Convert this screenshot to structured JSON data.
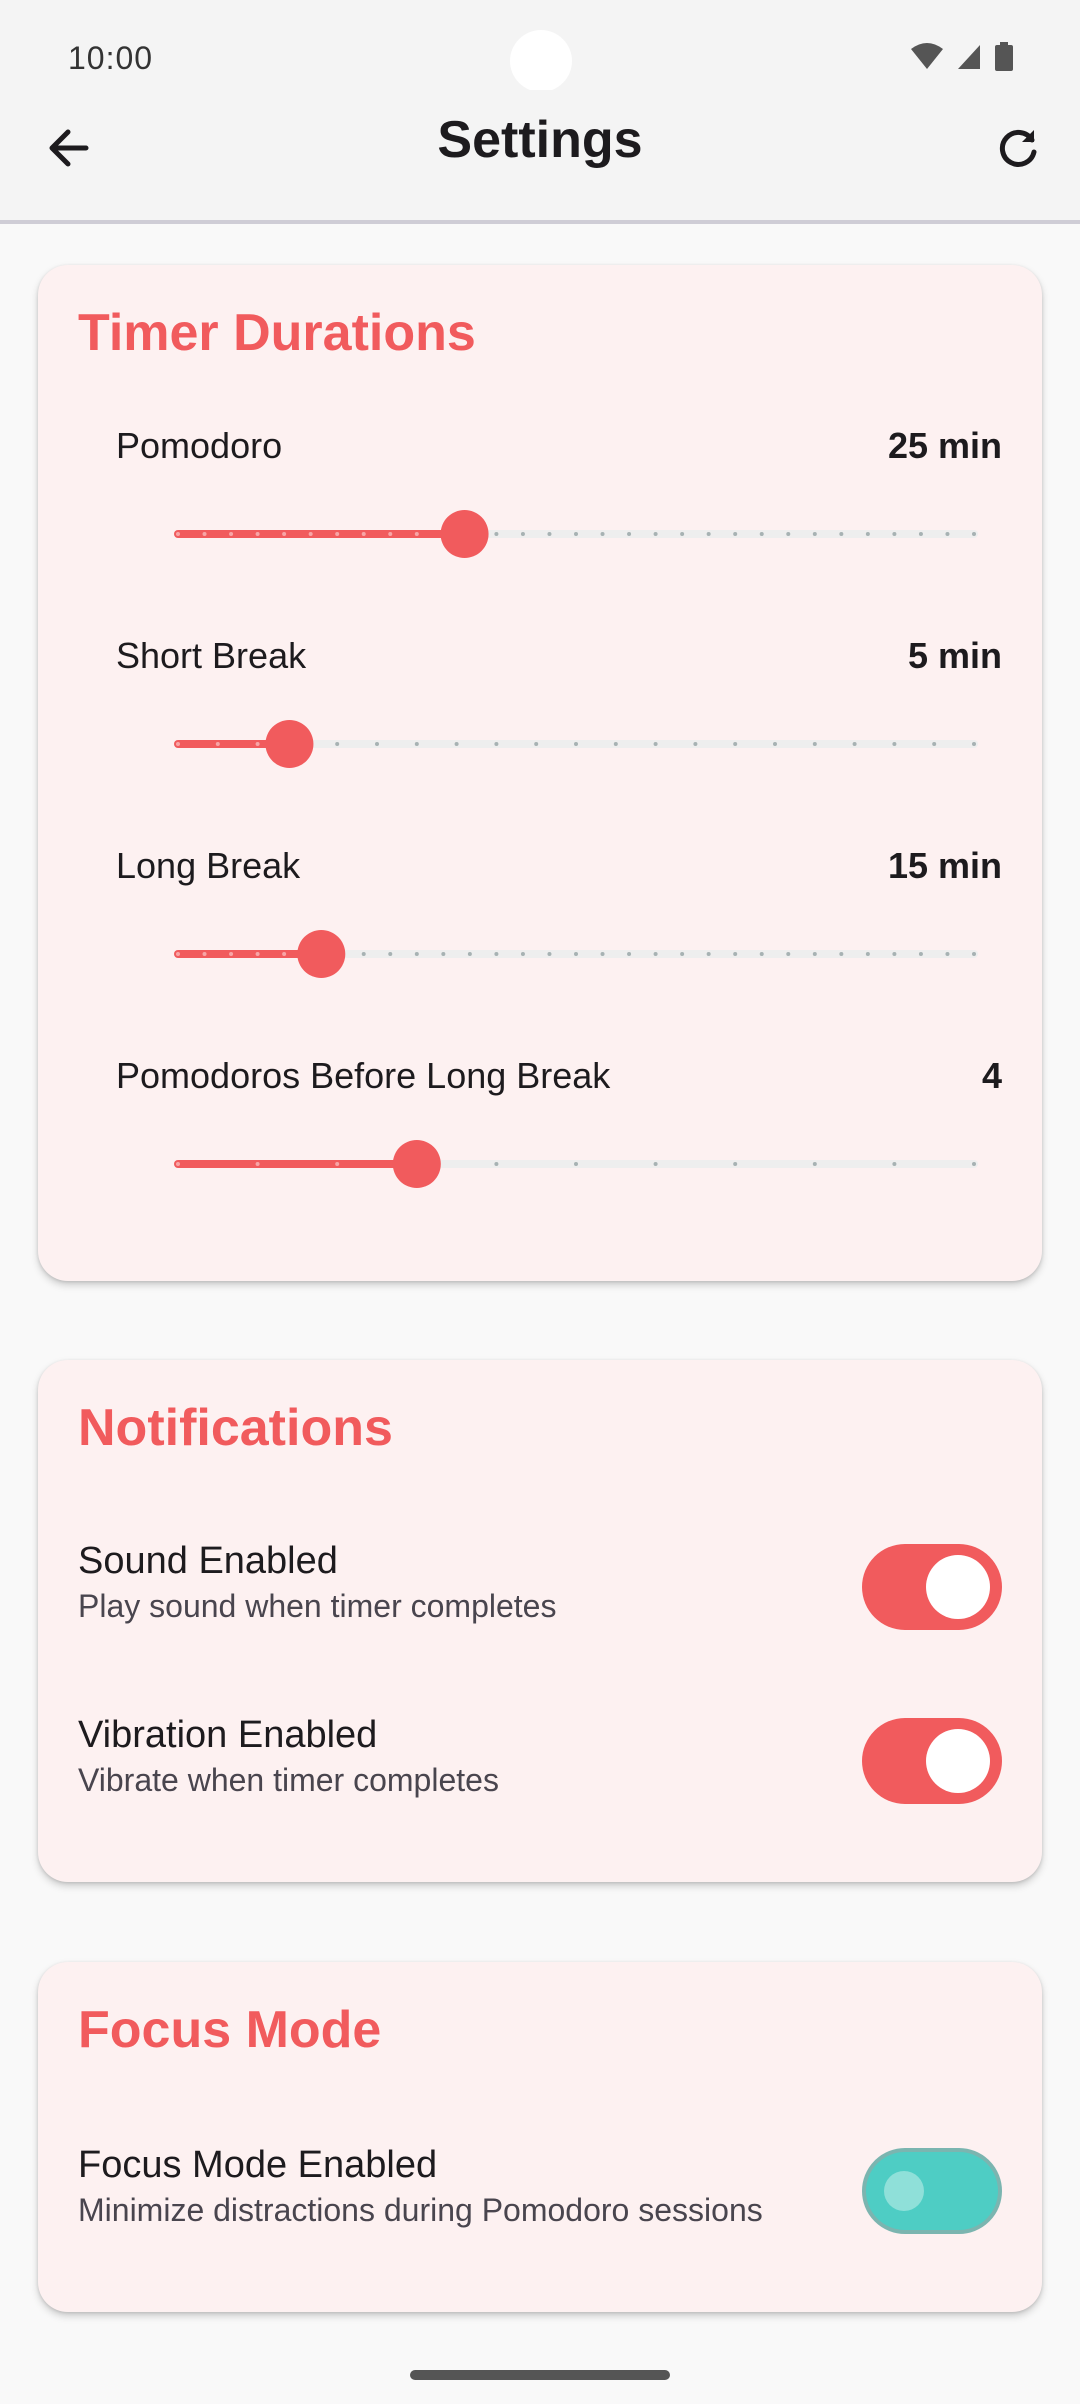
{
  "status": {
    "time": "10:00"
  },
  "app_bar": {
    "title": "Settings"
  },
  "colors": {
    "accent": "#f15b5d",
    "focus_accent": "#4ecdc4",
    "card_bg": "#fdf1f1"
  },
  "timer_durations": {
    "title": "Timer Durations",
    "sliders": [
      {
        "label": "Pomodoro",
        "value": "25 min",
        "fraction": 0.36,
        "ticks": 30
      },
      {
        "label": "Short Break",
        "value": "5 min",
        "fraction": 0.14,
        "ticks": 20
      },
      {
        "label": "Long Break",
        "value": "15 min",
        "fraction": 0.18,
        "ticks": 30
      },
      {
        "label": "Pomodoros Before Long Break",
        "value": "4",
        "fraction": 0.3,
        "ticks": 10
      }
    ]
  },
  "notifications": {
    "title": "Notifications",
    "items": [
      {
        "title": "Sound Enabled",
        "subtitle": "Play sound when timer completes",
        "on": true
      },
      {
        "title": "Vibration Enabled",
        "subtitle": "Vibrate when timer completes",
        "on": true
      }
    ]
  },
  "focus_mode": {
    "title": "Focus Mode",
    "items": [
      {
        "title": "Focus Mode Enabled",
        "subtitle": "Minimize distractions during Pomodoro sessions",
        "on": false
      }
    ]
  },
  "icons": {
    "back": "arrow-left-icon",
    "refresh": "refresh-icon",
    "wifi": "wifi-icon",
    "signal": "signal-icon",
    "battery": "battery-icon"
  }
}
